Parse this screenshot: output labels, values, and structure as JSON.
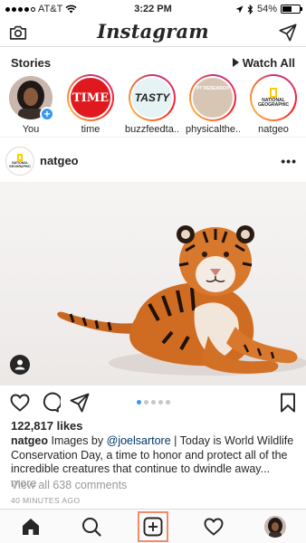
{
  "status_bar": {
    "carrier": "AT&T",
    "time": "3:22 PM",
    "battery": "54%",
    "battery_level": 0.54
  },
  "top_nav": {
    "logo": "Instagram",
    "left_icon": "camera-icon",
    "right_icon": "direct-message-icon"
  },
  "stories": {
    "label": "Stories",
    "watch_all": "Watch All",
    "items": [
      {
        "name": "You",
        "ring": false,
        "icon": "user-avatar"
      },
      {
        "name": "time",
        "ring": true,
        "logo": "TIME"
      },
      {
        "name": "buzzfeedta...",
        "ring": true,
        "logo": "TASTY"
      },
      {
        "name": "physicalthe...",
        "ring": true,
        "logo": "PT RESEARCH"
      },
      {
        "name": "natgeo",
        "ring": true,
        "logo": "NATIONAL GEOGRAPHIC"
      }
    ]
  },
  "post": {
    "username": "natgeo",
    "avatar_logo": "NATIONAL GEOGRAPHIC",
    "more_icon": "more-options-icon",
    "carousel": {
      "count": 5,
      "active": 0
    },
    "likes": "122,817 likes",
    "caption": {
      "user": "natgeo",
      "lead": "Images by",
      "mention": "@joelsartore",
      "text": "| Today is World Wildlife Conservation Day, a time to honor and protect all of the incredible creatures that continue to dwindle away...",
      "more": "more"
    },
    "comments_link": "View all 638 comments",
    "time_ago": "40 MINUTES AGO"
  },
  "bottom_nav": {
    "items": [
      "home-icon",
      "search-icon",
      "new-post-icon",
      "activity-heart-icon",
      "profile-avatar"
    ],
    "highlight_color": "#f08a6b"
  },
  "colors": {
    "accent_blue": "#3897f0",
    "text": "#262626",
    "muted": "#999999"
  }
}
